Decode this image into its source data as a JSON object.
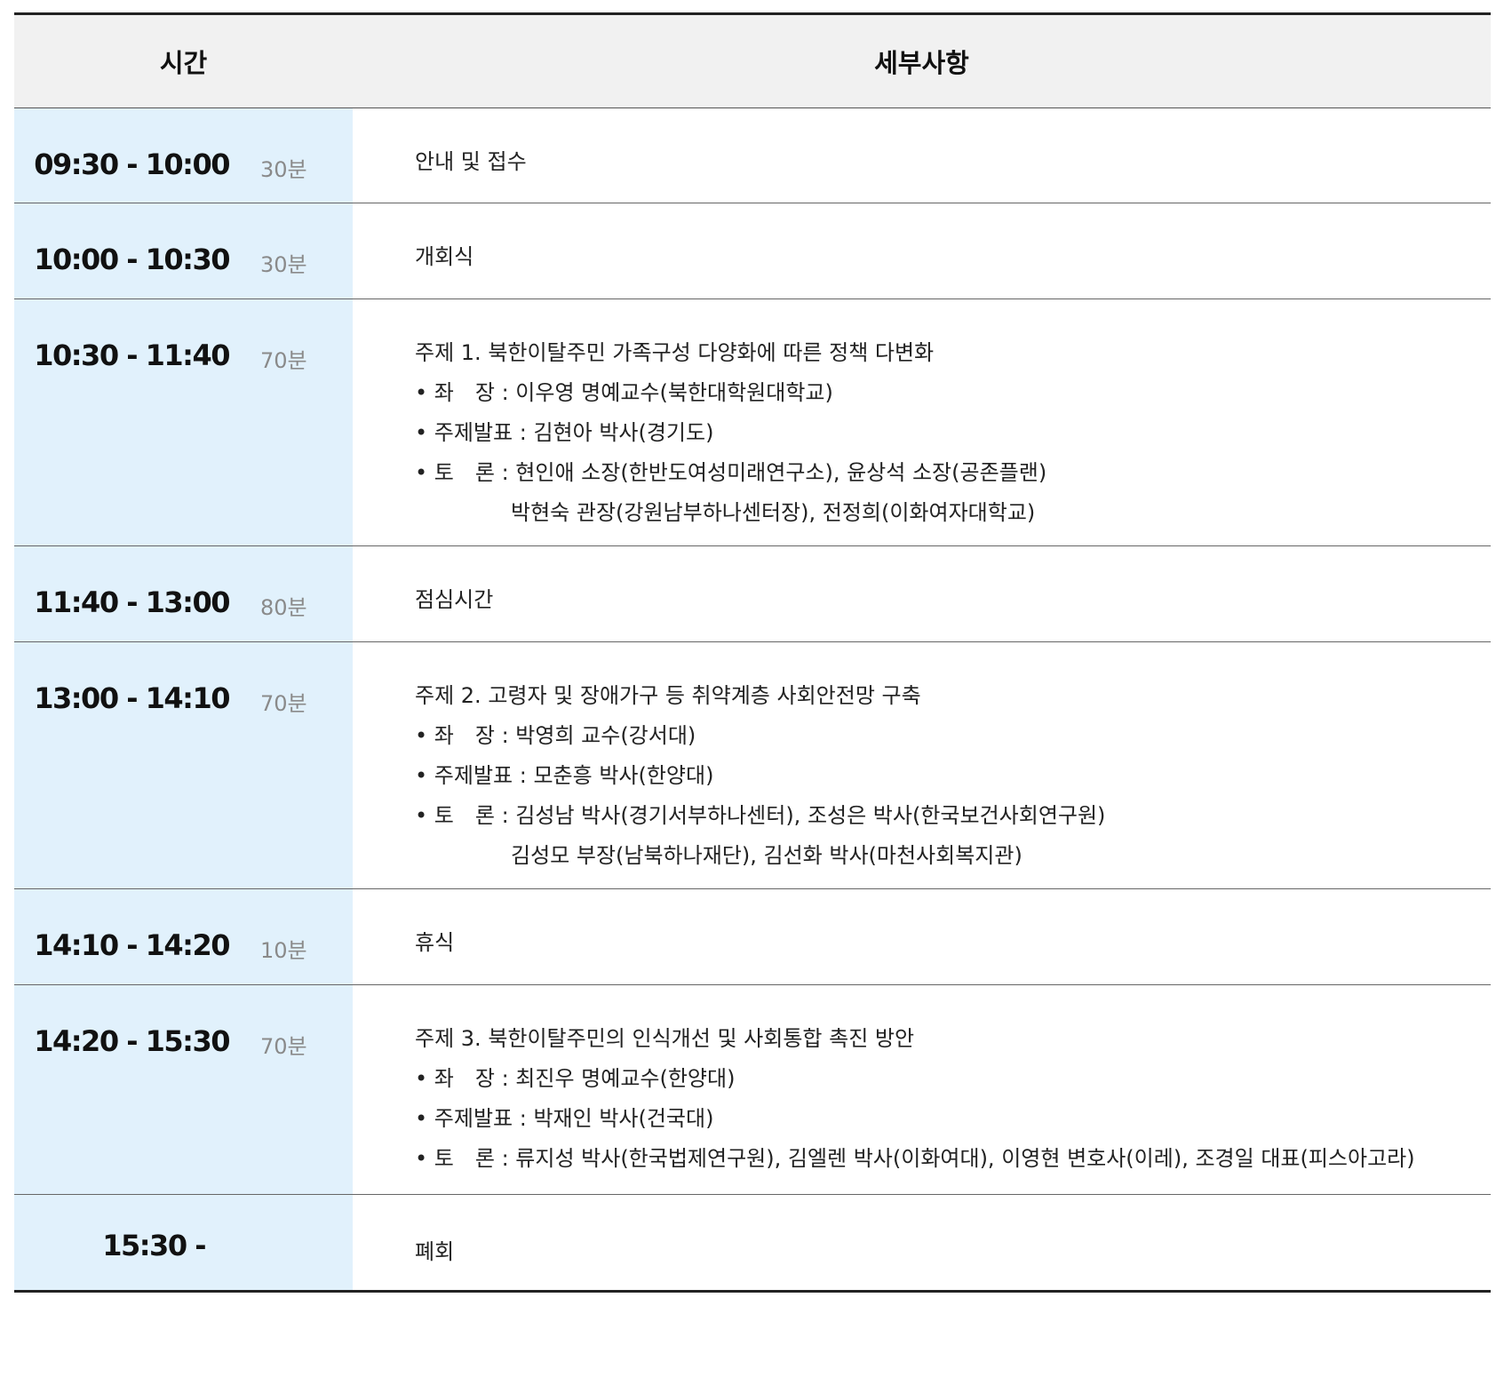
{
  "header": {
    "time": "시간",
    "detail": "세부사항"
  },
  "rows": [
    {
      "time": "09:30 - 10:00",
      "duration": "30분",
      "lines": [
        "안내 및 접수"
      ]
    },
    {
      "time": "10:00 - 10:30",
      "duration": "30분",
      "lines": [
        "개회식"
      ]
    },
    {
      "time": "10:30 - 11:40",
      "duration": "70분",
      "lines": [
        "주제 1. 북한이탈주민 가족구성 다양화에 따른 정책 다변화",
        "• 좌　장 : 이우영 명예교수(북한대학원대학교)",
        "• 주제발표 : 김현아 박사(경기도)",
        "• 토　론 : 현인애 소장(한반도여성미래연구소), 윤상석 소장(공존플랜)",
        "박현숙 관장(강원남부하나센터장), 전정희(이화여자대학교)"
      ]
    },
    {
      "time": "11:40 - 13:00",
      "duration": "80분",
      "lines": [
        "점심시간"
      ]
    },
    {
      "time": "13:00 - 14:10",
      "duration": "70분",
      "lines": [
        "주제 2. 고령자 및 장애가구 등 취약계층 사회안전망 구축",
        "• 좌　장 : 박영희 교수(강서대)",
        "• 주제발표 : 모춘흥 박사(한양대)",
        "• 토　론 : 김성남 박사(경기서부하나센터), 조성은 박사(한국보건사회연구원)",
        "김성모 부장(남북하나재단), 김선화 박사(마천사회복지관)"
      ]
    },
    {
      "time": "14:10 - 14:20",
      "duration": "10분",
      "lines": [
        "휴식"
      ]
    },
    {
      "time": "14:20 - 15:30",
      "duration": "70분",
      "lines": [
        "주제 3. 북한이탈주민의 인식개선 및 사회통합 촉진 방안",
        "• 좌　장 : 최진우 명예교수(한양대)",
        "• 주제발표 : 박재인 박사(건국대)",
        "• 토　론 : 류지성 박사(한국법제연구원), 김엘렌 박사(이화여대), 이영현 변호사(이레), 조경일 대표(피스아고라)"
      ]
    },
    {
      "time": "15:30 -",
      "duration": "",
      "lines": [
        "폐회"
      ]
    }
  ]
}
